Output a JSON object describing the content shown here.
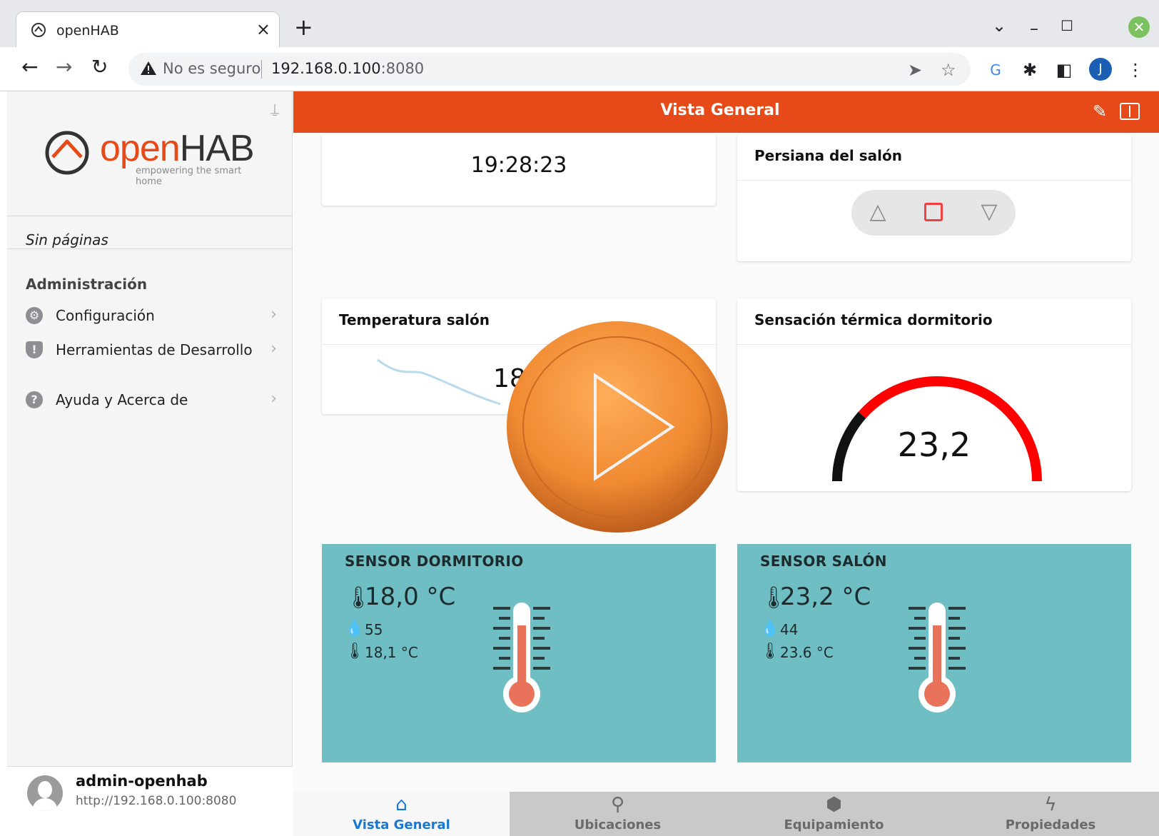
{
  "browser": {
    "tab_title": "openHAB",
    "tab_close": "×",
    "new_tab": "+",
    "not_secure": "No es seguro",
    "url_host": "192.168.0.100",
    "url_port": ":8080",
    "profile_initial": "J"
  },
  "sidebar": {
    "logo_open": "open",
    "logo_hab": "HAB",
    "logo_tagline": "empowering the smart home",
    "no_pages": "Sin páginas",
    "admin_heading": "Administración",
    "items": [
      {
        "label": "Configuración",
        "icon": "gear-icon"
      },
      {
        "label": "Herramientas de Desarrollo",
        "icon": "shield-icon"
      },
      {
        "label": "Ayuda y Acerca de",
        "icon": "help-icon"
      }
    ],
    "user_name": "admin-openhab",
    "user_url": "http://192.168.0.100:8080"
  },
  "navbar": {
    "title": "Vista General"
  },
  "cards": {
    "clock": "19:28:23",
    "rollershutter_title": "Persiana del salón",
    "temp_title": "Temperatura salón",
    "temp_value": "18",
    "gauge_title": "Sensación térmica dormitorio",
    "gauge_value": "23,2",
    "gauge_min_fraction": 0,
    "gauge_level_fraction": 0.23
  },
  "sensors": [
    {
      "title": "SENSOR DORMITORIO",
      "temp": "18,0 °C",
      "humidity": "55",
      "feels": "18,1 °C"
    },
    {
      "title": "SENSOR SALÓN",
      "temp": "23,2 °C",
      "humidity": "44",
      "feels": "23.6 °C"
    }
  ],
  "tabbar": [
    {
      "label": "Vista General",
      "icon": "home-icon"
    },
    {
      "label": "Ubicaciones",
      "icon": "location-icon"
    },
    {
      "label": "Equipamiento",
      "icon": "cube-icon"
    },
    {
      "label": "Propiedades",
      "icon": "bolt-icon"
    }
  ],
  "colors": {
    "accent": "#e64a19",
    "sensor_bg": "#6fbec4",
    "gauge_active": "#ff0000",
    "tab_active": "#1976d2"
  }
}
